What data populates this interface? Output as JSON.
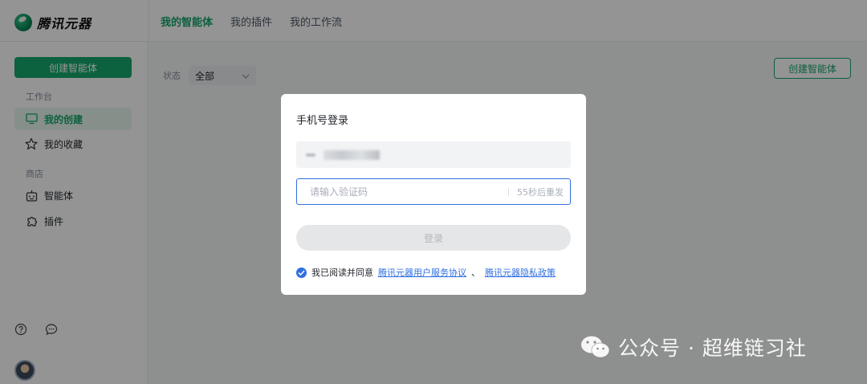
{
  "app": {
    "brand": "腾讯元器"
  },
  "nav": {
    "tabs": [
      "我的智能体",
      "我的插件",
      "我的工作流"
    ]
  },
  "sidebar": {
    "create_button": "创建智能体",
    "section_workspace": "工作台",
    "item_my_created": "我的创建",
    "item_my_favorites": "我的收藏",
    "section_store": "商店",
    "item_agents": "智能体",
    "item_plugins": "插件"
  },
  "main": {
    "filter_label": "状态",
    "filter_value": "全部",
    "create_button": "创建智能体"
  },
  "modal": {
    "title": "手机号登录",
    "code_placeholder": "请输入验证码",
    "resend_text": "55秒后重发",
    "login_button": "登录",
    "agree_prefix": "我已阅读并同意",
    "agreement_link": "腾讯元器用户服务协议",
    "separator": "、",
    "privacy_link": "腾讯元器隐私政策"
  },
  "watermark": {
    "text": "公众号 · 超维链习社"
  },
  "colors": {
    "accent_green": "#16a86b",
    "accent_blue": "#2f6fe0"
  }
}
